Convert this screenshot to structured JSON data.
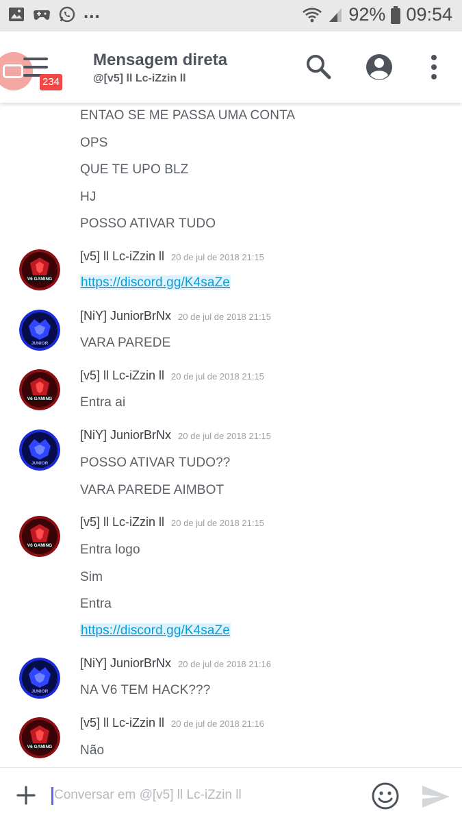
{
  "status_bar": {
    "battery": "92%",
    "time": "09:54",
    "overflow": "...",
    "left_icons": [
      "gallery-icon",
      "game-controller-icon",
      "whatsapp-icon"
    ],
    "right_icons": [
      "wifi-icon",
      "signal-icon",
      "battery-icon"
    ]
  },
  "app_bar": {
    "title": "Mensagem direta",
    "subtitle": "@[v5] ll Lc-iZzin ll",
    "badge_count": "234",
    "icons": [
      "menu-icon",
      "search-icon",
      "profile-icon",
      "more-vert-icon"
    ]
  },
  "colors": {
    "link": "#0a9ed7",
    "link_bg": "#dff1fa",
    "badge": "#f04747",
    "icon_gray": "#4f545c",
    "avatar_v5": "#8b0e12",
    "avatar_junior": "#1a2bd6"
  },
  "messages": {
    "cont_1": "ENTAO SE ME PASSA UMA CONTA",
    "cont_2": "OPS",
    "cont_3": "QUE TE UPO BLZ",
    "cont_4": "HJ",
    "cont_5": "POSSO ATIVAR TUDO",
    "g1": {
      "author": "[v5] ll Lc-iZzin ll",
      "time": "20 de jul de 2018 21:15",
      "avatar_text": "V6 GAMING",
      "lines": [
        "https://discord.gg/K4saZe"
      ]
    },
    "g2": {
      "author": "[NiY] JuniorBrNx",
      "time": "20 de jul de 2018 21:15",
      "avatar_text": "JUNIOR",
      "lines": [
        "VARA PAREDE"
      ]
    },
    "g3": {
      "author": "[v5] ll Lc-iZzin ll",
      "time": "20 de jul de 2018 21:15",
      "avatar_text": "V6 GAMING",
      "lines": [
        "Entra ai"
      ]
    },
    "g4": {
      "author": "[NiY] JuniorBrNx",
      "time": "20 de jul de 2018 21:15",
      "avatar_text": "JUNIOR",
      "lines": [
        "POSSO ATIVAR TUDO??",
        "VARA PAREDE AIMBOT"
      ]
    },
    "g5": {
      "author": "[v5] ll Lc-iZzin ll",
      "time": "20 de jul de 2018 21:15",
      "avatar_text": "V6 GAMING",
      "lines": [
        "Entra logo",
        "Sim",
        "Entra",
        "https://discord.gg/K4saZe"
      ]
    },
    "g6": {
      "author": "[NiY] JuniorBrNx",
      "time": "20 de jul de 2018 21:16",
      "avatar_text": "JUNIOR",
      "lines": [
        "NA V6 TEM HACK???"
      ]
    },
    "g7": {
      "author": "[v5] ll Lc-iZzin ll",
      "time": "20 de jul de 2018 21:16",
      "avatar_text": "V6 GAMING",
      "lines": [
        "Não"
      ]
    }
  },
  "composer": {
    "placeholder": "Conversar em @[v5] ll Lc-iZzin ll",
    "icons": [
      "plus-icon",
      "emoji-icon",
      "send-icon"
    ]
  }
}
